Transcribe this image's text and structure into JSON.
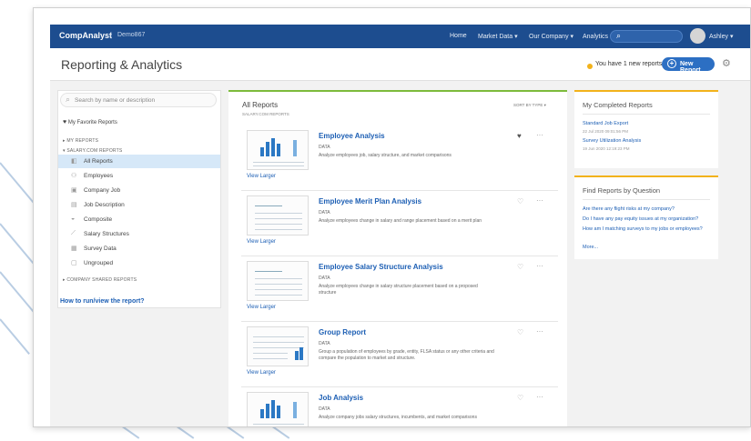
{
  "colors": {
    "topbar": "#1d4d8f",
    "accent_blue": "#1d5fb4",
    "new_report_button": "#2c6fc3",
    "main_panel_border": "#7dbb3b",
    "right_panel_border": "#f2b21b",
    "active_item": "#d6e8f8"
  },
  "topbar": {
    "brand": "CompAnalyst",
    "client": "Demo867",
    "nav": [
      "Home",
      "Market Data ▾",
      "Our Company ▾",
      "Analytics ▾"
    ],
    "user": "Ashley ▾",
    "search_icon": "search-icon",
    "avatar_icon": "user-avatar-icon"
  },
  "header": {
    "title": "Reporting & Analytics",
    "notification": "You have 1 new reports",
    "new_report_label": "New Report",
    "settings_icon": "gear-icon"
  },
  "sidebar": {
    "search_placeholder": "Search by name or description",
    "favorites_label": "My Favorite Reports",
    "my_reports_label": "MY REPORTS",
    "salary_reports_label": "SALARY.COM REPORTS",
    "items": [
      {
        "label": "All Reports",
        "icon": "folder-icon"
      },
      {
        "label": "Employees",
        "icon": "people-icon"
      },
      {
        "label": "Company Job",
        "icon": "briefcase-icon"
      },
      {
        "label": "Job Description",
        "icon": "document-icon"
      },
      {
        "label": "Composite",
        "icon": "composite-icon"
      },
      {
        "label": "Salary Structures",
        "icon": "structure-icon"
      },
      {
        "label": "Survey Data",
        "icon": "survey-icon"
      },
      {
        "label": "Ungrouped",
        "icon": "folder-icon"
      }
    ],
    "company_shared_label": "COMPANY SHARED REPORTS",
    "help_link": "How to run/view the report?"
  },
  "main": {
    "title": "All Reports",
    "subtitle": "SALARY.COM REPORTS",
    "sort_label": "SORT BY TYPE ▾",
    "view_larger": "View Larger",
    "cards": [
      {
        "name": "Employee Analysis",
        "type": "DATA",
        "description": "Analyze employees job, salary structure, and market comparisons",
        "favorite": true
      },
      {
        "name": "Employee Merit Plan Analysis",
        "type": "DATA",
        "description": "Analyze employees change in salary and range placement based on a merit plan",
        "favorite": false
      },
      {
        "name": "Employee Salary Structure Analysis",
        "type": "DATA",
        "description": "Analyze employees change in salary structure placement based on a proposed structure",
        "favorite": false
      },
      {
        "name": "Group Report",
        "type": "DATA",
        "description": "Group a population of employees by grade, entity, FLSA status or any other criteria and compare the population to market and structure.",
        "favorite": false
      },
      {
        "name": "Job Analysis",
        "type": "DATA",
        "description": "Analyze company jobs salary structures, incumbents, and market comparisons",
        "favorite": false
      }
    ]
  },
  "completed": {
    "title": "My Completed Reports",
    "items": [
      {
        "name": "Standard Job Export",
        "date": "22 Jul 2020 09:01:56 PM"
      },
      {
        "name": "Survey Utilization Analysis",
        "date": "19 Jun 2020 12:19:23 PM"
      }
    ]
  },
  "questions": {
    "title": "Find Reports by Question",
    "items": [
      "Are there any flight risks at my company?",
      "Do I have any pay equity issues at my organization?",
      "How am I matching surveys to my jobs or employees?",
      "More..."
    ]
  }
}
